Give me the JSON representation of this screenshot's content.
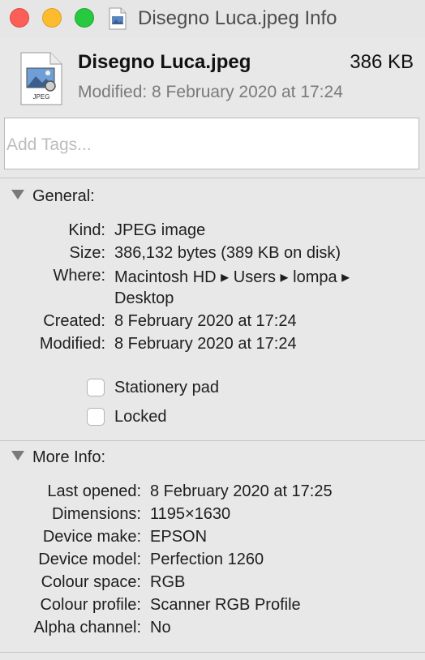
{
  "window": {
    "title": "Disegno Luca.jpeg Info"
  },
  "header": {
    "file_name": "Disegno Luca.jpeg",
    "file_size": "386 KB",
    "modified": "Modified: 8 February 2020 at 17:24",
    "icon_badge": "JPEG"
  },
  "tags": {
    "placeholder": "Add Tags..."
  },
  "general": {
    "heading": "General:",
    "rows": [
      {
        "label": "Kind:",
        "value": "JPEG image"
      },
      {
        "label": "Size:",
        "value": "386,132 bytes (389 KB on disk)"
      },
      {
        "label": "Where:",
        "value": "Macintosh HD ▸ Users ▸ lompa ▸",
        "value2": "Desktop"
      },
      {
        "label": "Created:",
        "value": "8 February 2020 at 17:24"
      },
      {
        "label": "Modified:",
        "value": "8 February 2020 at 17:24"
      }
    ],
    "stationery_label": "Stationery pad",
    "locked_label": "Locked"
  },
  "more_info": {
    "heading": "More Info:",
    "rows": [
      {
        "label": "Last opened:",
        "value": "8 February 2020 at 17:25"
      },
      {
        "label": "Dimensions:",
        "value": "1195×1630"
      },
      {
        "label": "Device make:",
        "value": "EPSON"
      },
      {
        "label": "Device model:",
        "value": "Perfection 1260"
      },
      {
        "label": "Colour space:",
        "value": "RGB"
      },
      {
        "label": "Colour profile:",
        "value": "Scanner RGB Profile"
      },
      {
        "label": "Alpha channel:",
        "value": "No"
      }
    ]
  }
}
